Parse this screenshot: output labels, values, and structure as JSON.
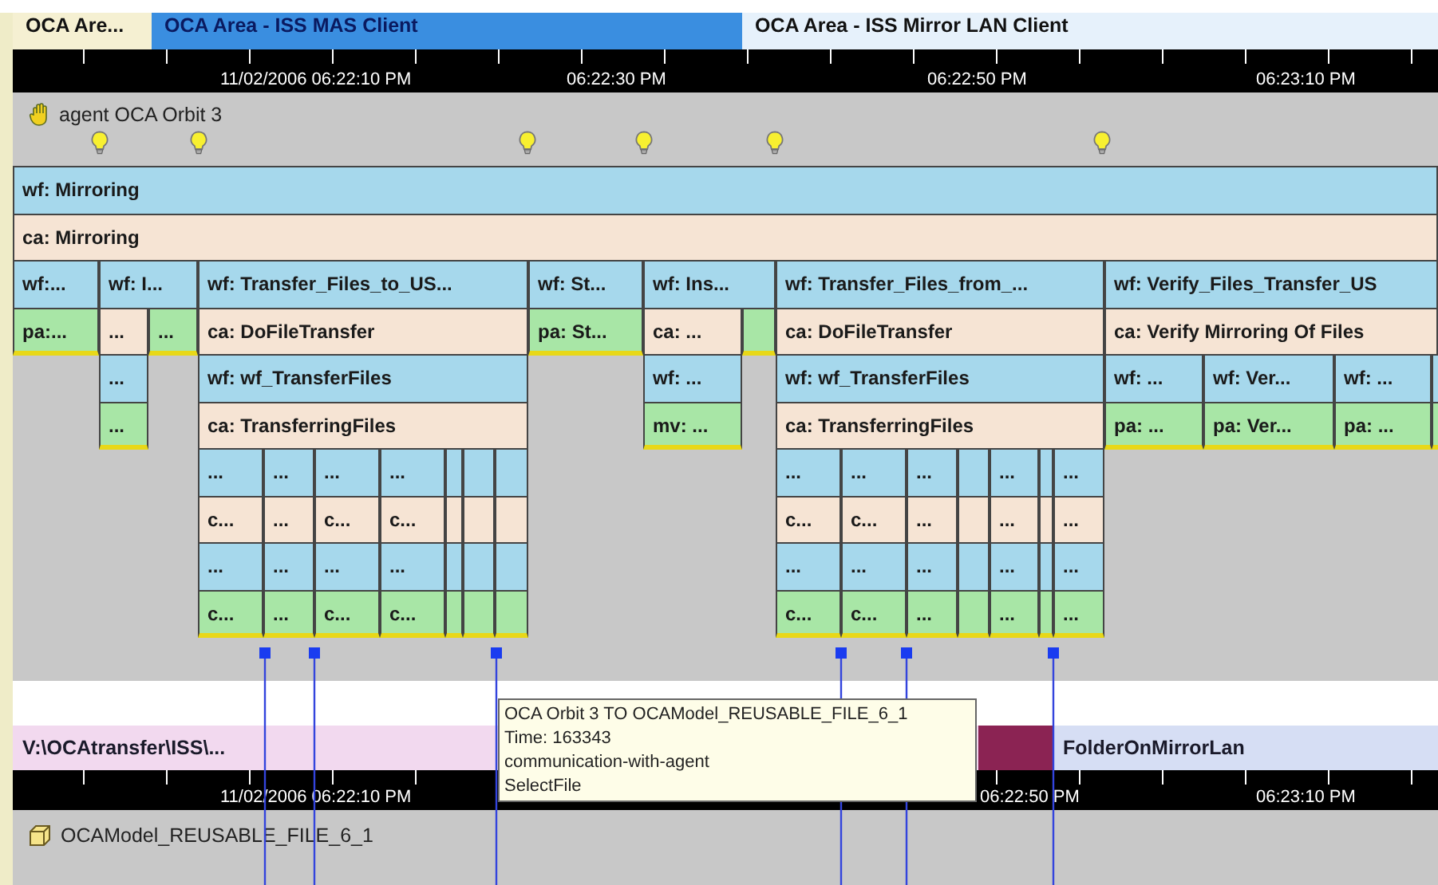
{
  "area_tabs": [
    {
      "label": "OCA Are...",
      "selected": false,
      "color": "#f5f0d2"
    },
    {
      "label": "OCA Area - ISS MAS Client",
      "selected": true,
      "color": "#3a8ee0"
    },
    {
      "label": "OCA Area - ISS Mirror LAN Client",
      "selected": false,
      "color": "#e6f1fb"
    }
  ],
  "top_ruler": {
    "labels": [
      "11/02/2006 06:22:10 PM",
      "06:22:30 PM",
      "06:22:50 PM",
      "06:23:10 PM"
    ]
  },
  "agent": {
    "name": "agent OCA Orbit 3"
  },
  "swimlanes": [
    {
      "blocks": [
        {
          "kind": "wf",
          "label": "wf: Mirroring"
        }
      ]
    },
    {
      "blocks": [
        {
          "kind": "ca",
          "label": "ca: Mirroring"
        }
      ]
    },
    {
      "blocks": [
        {
          "kind": "wf",
          "label": "wf:..."
        },
        {
          "kind": "wf",
          "label": "wf: I..."
        },
        {
          "kind": "wf",
          "label": "wf: Transfer_Files_to_US..."
        },
        {
          "kind": "wf",
          "label": "wf: St..."
        },
        {
          "kind": "wf",
          "label": "wf: Ins..."
        },
        {
          "kind": "wf",
          "label": "wf: Transfer_Files_from_..."
        },
        {
          "kind": "wf",
          "label": "wf: Verify_Files_Transfer_US"
        }
      ]
    },
    {
      "blocks": [
        {
          "kind": "pa",
          "label": "pa:..."
        },
        {
          "kind": "ca",
          "label": "..."
        },
        {
          "kind": "pa",
          "label": "..."
        },
        {
          "kind": "ca",
          "label": "ca: DoFileTransfer"
        },
        {
          "kind": "pa",
          "label": "pa: St..."
        },
        {
          "kind": "ca",
          "label": "ca: ..."
        },
        {
          "kind": "pa"
        },
        {
          "kind": "ca",
          "label": "ca: DoFileTransfer"
        },
        {
          "kind": "ca",
          "label": "ca: Verify Mirroring Of Files"
        }
      ]
    },
    {
      "blocks": [
        {
          "kind": "wf",
          "label": "..."
        },
        {
          "kind": "wf",
          "label": "wf: wf_TransferFiles"
        },
        {
          "kind": "wf",
          "label": "wf: ..."
        },
        {
          "kind": "wf",
          "label": "wf: wf_TransferFiles"
        },
        {
          "kind": "wf",
          "label": "wf: ..."
        },
        {
          "kind": "wf",
          "label": "wf: Ver..."
        },
        {
          "kind": "wf",
          "label": "wf: ..."
        },
        {
          "kind": "wf"
        }
      ]
    },
    {
      "blocks": [
        {
          "kind": "pa",
          "label": "..."
        },
        {
          "kind": "ca",
          "label": "ca: TransferringFiles"
        },
        {
          "kind": "mv",
          "label": "mv: ..."
        },
        {
          "kind": "ca",
          "label": "ca: TransferringFiles"
        },
        {
          "kind": "pa",
          "label": "pa: ..."
        },
        {
          "kind": "pa",
          "label": "pa: Ver..."
        },
        {
          "kind": "pa",
          "label": "pa: ..."
        },
        {
          "kind": "pa"
        }
      ]
    },
    {
      "blocks": [
        {
          "kind": "wf",
          "label": "..."
        },
        {
          "kind": "wf",
          "label": "..."
        },
        {
          "kind": "wf",
          "label": "..."
        },
        {
          "kind": "wf",
          "label": "..."
        },
        {
          "kind": "wf"
        },
        {
          "kind": "wf"
        },
        {
          "kind": "wf"
        },
        {
          "kind": "wf",
          "label": "..."
        },
        {
          "kind": "wf",
          "label": "..."
        },
        {
          "kind": "wf",
          "label": "..."
        },
        {
          "kind": "wf"
        },
        {
          "kind": "wf",
          "label": "..."
        },
        {
          "kind": "wf"
        },
        {
          "kind": "wf",
          "label": "..."
        }
      ]
    },
    {
      "blocks": [
        {
          "kind": "ca",
          "label": "c..."
        },
        {
          "kind": "ca",
          "label": "..."
        },
        {
          "kind": "ca",
          "label": "c..."
        },
        {
          "kind": "ca",
          "label": "c..."
        },
        {
          "kind": "ca"
        },
        {
          "kind": "ca"
        },
        {
          "kind": "ca"
        },
        {
          "kind": "ca",
          "label": "c..."
        },
        {
          "kind": "ca",
          "label": "c..."
        },
        {
          "kind": "ca",
          "label": "..."
        },
        {
          "kind": "ca"
        },
        {
          "kind": "ca",
          "label": "..."
        },
        {
          "kind": "ca"
        },
        {
          "kind": "ca",
          "label": "..."
        }
      ]
    },
    {
      "blocks": [
        {
          "kind": "wf",
          "label": "..."
        },
        {
          "kind": "wf",
          "label": "..."
        },
        {
          "kind": "wf",
          "label": "..."
        },
        {
          "kind": "wf",
          "label": "..."
        },
        {
          "kind": "wf"
        },
        {
          "kind": "wf"
        },
        {
          "kind": "wf"
        },
        {
          "kind": "wf",
          "label": "..."
        },
        {
          "kind": "wf",
          "label": "..."
        },
        {
          "kind": "wf",
          "label": "..."
        },
        {
          "kind": "wf"
        },
        {
          "kind": "wf",
          "label": "..."
        },
        {
          "kind": "wf"
        },
        {
          "kind": "wf",
          "label": "..."
        }
      ]
    },
    {
      "blocks": [
        {
          "kind": "pa",
          "label": "c..."
        },
        {
          "kind": "pa",
          "label": "..."
        },
        {
          "kind": "pa",
          "label": "c..."
        },
        {
          "kind": "pa",
          "label": "c..."
        },
        {
          "kind": "pa"
        },
        {
          "kind": "pa"
        },
        {
          "kind": "pa"
        },
        {
          "kind": "pa",
          "label": "c..."
        },
        {
          "kind": "pa",
          "label": "c..."
        },
        {
          "kind": "pa",
          "label": "..."
        },
        {
          "kind": "pa"
        },
        {
          "kind": "pa",
          "label": "..."
        },
        {
          "kind": "pa"
        },
        {
          "kind": "pa",
          "label": "..."
        }
      ]
    }
  ],
  "tooltip": {
    "lines": [
      "OCA Orbit 3 TO OCAModel_REUSABLE_FILE_6_1",
      "Time: 163343",
      "communication-with-agent",
      "SelectFile"
    ]
  },
  "bottom_lane": {
    "segments": [
      {
        "label": "V:\\OCAtransfer\\ISS\\...",
        "color": "#f2d9ef"
      },
      {
        "color": "#8b2353"
      },
      {
        "label": "FolderOnMirrorLan",
        "color": "#d6def4"
      }
    ]
  },
  "bottom_ruler": {
    "labels": [
      "11/02/2006 06:22:10 PM",
      "06:22:50 PM",
      "06:23:10 PM"
    ]
  },
  "object": {
    "name": "OCAModel_REUSABLE_FILE_6_1"
  }
}
